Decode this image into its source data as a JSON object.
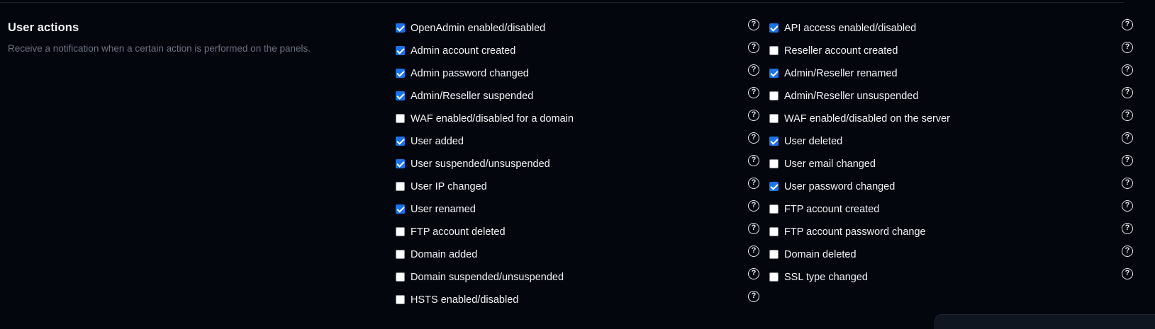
{
  "section": {
    "title": "User actions",
    "description": "Receive a notification when a certain action is performed on the panels."
  },
  "help_icon_glyph": "?",
  "colors": {
    "background": "#03060d",
    "checkbox_checked": "#1a73e8",
    "description_text": "#6b7280"
  },
  "options_left": [
    {
      "label": "OpenAdmin enabled/disabled",
      "checked": true
    },
    {
      "label": "Admin account created",
      "checked": true
    },
    {
      "label": "Admin password changed",
      "checked": true
    },
    {
      "label": "Admin/Reseller suspended",
      "checked": true
    },
    {
      "label": "WAF enabled/disabled for a domain",
      "checked": false
    },
    {
      "label": "User added",
      "checked": true
    },
    {
      "label": "User suspended/unsuspended",
      "checked": true
    },
    {
      "label": "User IP changed",
      "checked": false
    },
    {
      "label": "User renamed",
      "checked": true
    },
    {
      "label": "FTP account deleted",
      "checked": false
    },
    {
      "label": "Domain added",
      "checked": false
    },
    {
      "label": "Domain suspended/unsuspended",
      "checked": false
    },
    {
      "label": "HSTS enabled/disabled",
      "checked": false
    }
  ],
  "options_right": [
    {
      "label": "API access enabled/disabled",
      "checked": true
    },
    {
      "label": "Reseller account created",
      "checked": false
    },
    {
      "label": "Admin/Reseller renamed",
      "checked": true
    },
    {
      "label": "Admin/Reseller unsuspended",
      "checked": false
    },
    {
      "label": "WAF enabled/disabled on the server",
      "checked": false
    },
    {
      "label": "User deleted",
      "checked": true
    },
    {
      "label": "User email changed",
      "checked": false
    },
    {
      "label": "User password changed",
      "checked": true
    },
    {
      "label": "FTP account created",
      "checked": false
    },
    {
      "label": "FTP account password change",
      "checked": false
    },
    {
      "label": "Domain deleted",
      "checked": false
    },
    {
      "label": "SSL type changed",
      "checked": false
    }
  ]
}
